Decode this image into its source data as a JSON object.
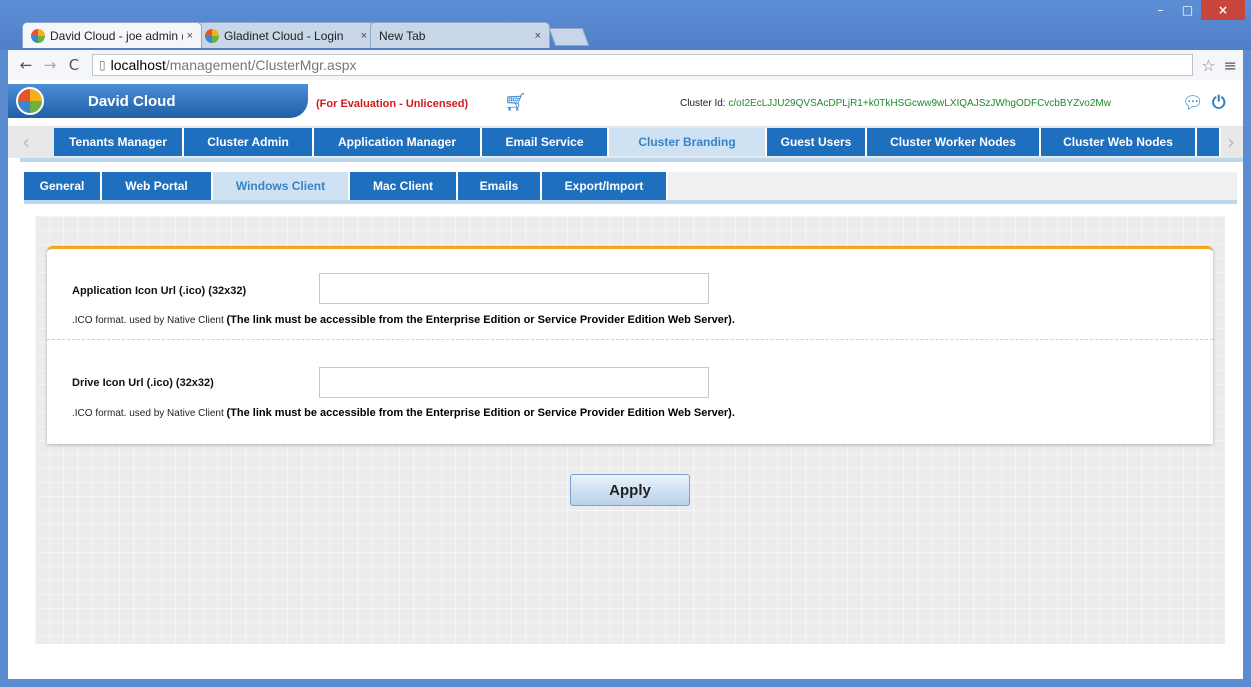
{
  "browser": {
    "tabs": [
      {
        "label": "David Cloud - joe admin (",
        "close": "×"
      },
      {
        "label": "Gladinet Cloud - Login",
        "close": "×"
      },
      {
        "label": "New Tab",
        "close": "×"
      }
    ],
    "url_host": "localhost",
    "url_path": "/management/ClusterMgr.aspx",
    "window_controls": {
      "minimize": "–",
      "maximize": "□",
      "close": "×"
    }
  },
  "header": {
    "brand_name": "David Cloud",
    "evaluation_notice": "(For Evaluation - Unlicensed)",
    "cluster_id_label": "Cluster Id:",
    "cluster_id_value": "c/oI2EcLJJU29QVSAcDPLjR1+k0TkHSGcww9wLXIQAJSzJWhgODFCvcbBYZvo2Mw"
  },
  "main_nav": {
    "items": [
      {
        "label": "Tenants Manager"
      },
      {
        "label": "Cluster Admin"
      },
      {
        "label": "Application Manager"
      },
      {
        "label": "Email Service"
      },
      {
        "label": "Cluster Branding"
      },
      {
        "label": "Guest Users"
      },
      {
        "label": "Cluster Worker Nodes"
      },
      {
        "label": "Cluster Web Nodes"
      }
    ],
    "active": "Cluster Branding"
  },
  "sub_nav": {
    "items": [
      {
        "label": "General"
      },
      {
        "label": "Web Portal"
      },
      {
        "label": "Windows Client"
      },
      {
        "label": "Mac Client"
      },
      {
        "label": "Emails"
      },
      {
        "label": "Export/Import"
      }
    ],
    "active": "Windows Client"
  },
  "form": {
    "app_icon": {
      "label": "Application Icon Url (.ico) (32x32)",
      "value": "",
      "help_plain": ".ICO format. used by Native Client ",
      "help_bold": "(The link must be accessible from the Enterprise Edition or Service Provider Edition Web Server)."
    },
    "drive_icon": {
      "label": "Drive Icon Url (.ico) (32x32)",
      "value": "",
      "help_plain": ".ICO format. used by Native Client ",
      "help_bold": "(The link must be accessible from the Enterprise Edition or Service Provider Edition Web Server)."
    },
    "apply_label": "Apply"
  },
  "icons": {
    "back": "back-arrow-icon",
    "forward": "forward-arrow-icon",
    "reload": "reload-icon",
    "bookmark": "star-icon",
    "menu": "hamburger-menu-icon",
    "cart": "shopping-cart-icon",
    "chat": "chat-bubble-icon",
    "power": "power-icon"
  },
  "colors": {
    "nav_blue": "#1f6fbf",
    "nav_active_bg": "#cfe2f3",
    "eval_red": "#d2191c",
    "cluster_id_green": "#1e8a29",
    "panel_accent": "#f5a623"
  }
}
